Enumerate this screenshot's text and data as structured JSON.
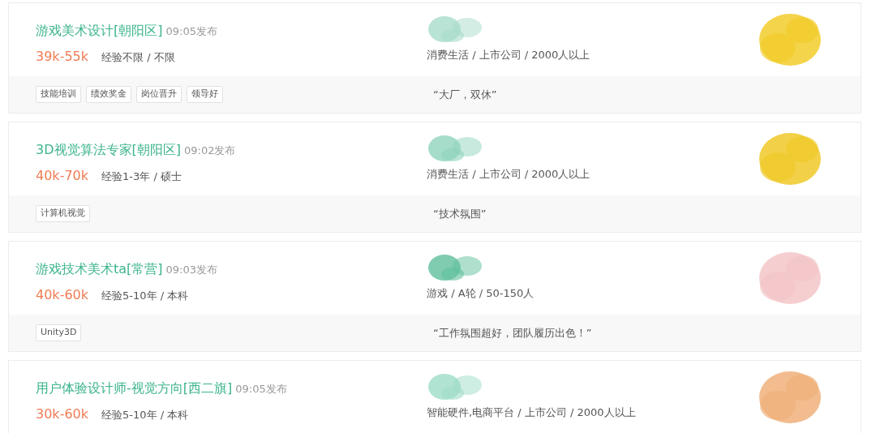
{
  "jobs": [
    {
      "title": "游戏美术设计[朝阳区]",
      "posted": "09:05发布",
      "salary": "39k-55k",
      "requirements": "经验不限 / 不限",
      "company_info": "消费生活 / 上市公司 / 2000人以上",
      "tags": [
        "技能培训",
        "绩效奖金",
        "岗位晋升",
        "领导好"
      ],
      "quote": "“大厂，双休”"
    },
    {
      "title": "3D视觉算法专家[朝阳区]",
      "posted": "09:02发布",
      "salary": "40k-70k",
      "requirements": "经验1-3年 / 硕士",
      "company_info": "消费生活 / 上市公司 / 2000人以上",
      "tags": [
        "计算机视觉"
      ],
      "quote": "“技术氛围”"
    },
    {
      "title": "游戏技术美术ta[常营]",
      "posted": "09:03发布",
      "salary": "40k-60k",
      "requirements": "经验5-10年 / 本科",
      "company_info": "游戏 / A轮 / 50-150人",
      "tags": [
        "Unity3D"
      ],
      "quote": "“工作氛围超好，团队履历出色！”"
    },
    {
      "title": "用户体验设计师-视觉方向[西二旗]",
      "posted": "09:05发布",
      "salary": "30k-60k",
      "requirements": "经验5-10年 / 本科",
      "company_info": "智能硬件,电商平台 / 上市公司 / 2000人以上"
    }
  ]
}
